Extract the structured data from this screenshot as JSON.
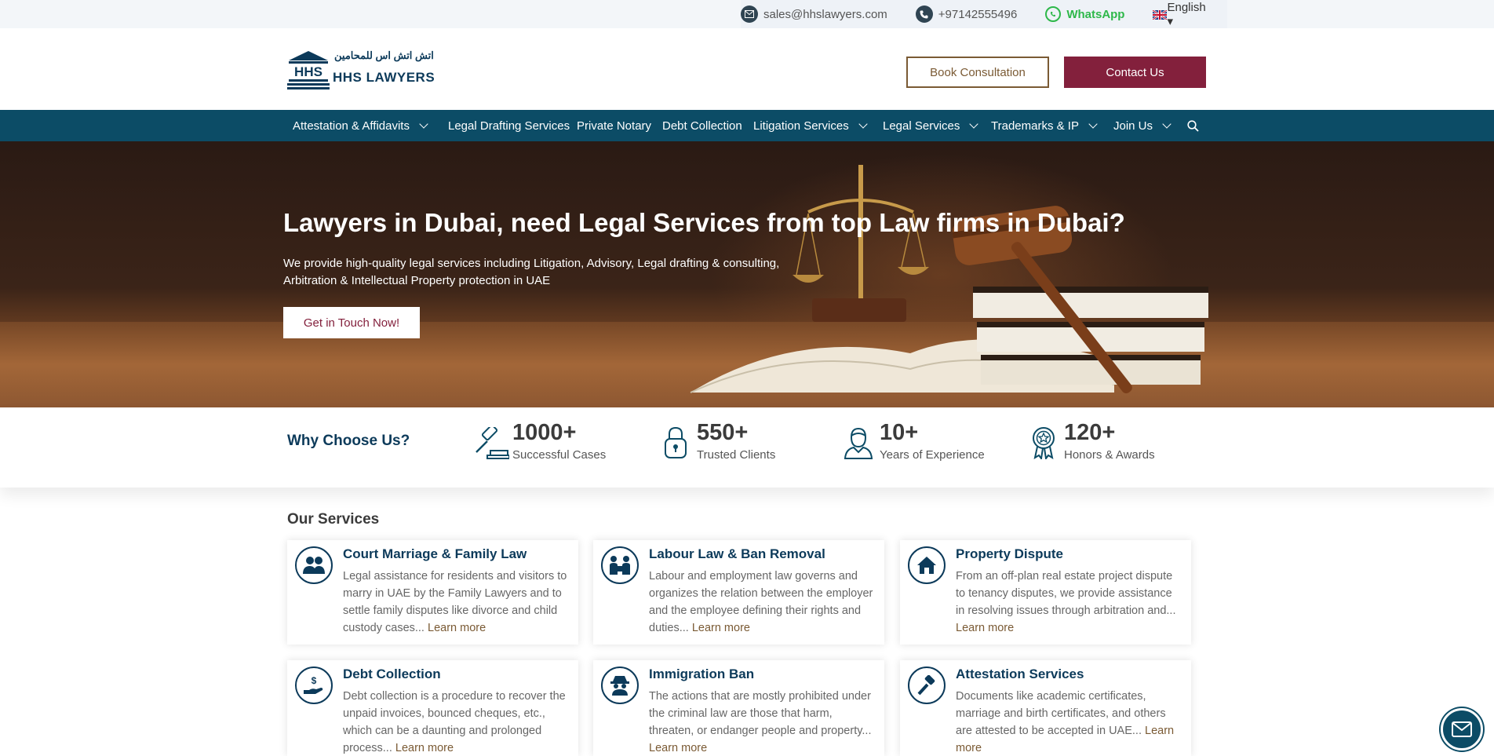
{
  "topbar": {
    "email": "sales@hhslawyers.com",
    "phone": "+97142555496",
    "whatsapp": "WhatsApp",
    "language": "English ▾"
  },
  "header": {
    "logo_mark": "HHS",
    "logo_arabic": "اتش اتش اس للمحامين",
    "logo_name": "HHS LAWYERS",
    "book_label": "Book Consultation",
    "contact_label": "Contact Us"
  },
  "nav": {
    "items": [
      {
        "label": "Attestation & Affidavits",
        "has_dropdown": true
      },
      {
        "label": "Legal Drafting Services",
        "has_dropdown": false
      },
      {
        "label": "Private Notary",
        "has_dropdown": false
      },
      {
        "label": "Debt Collection",
        "has_dropdown": false
      },
      {
        "label": "Litigation Services",
        "has_dropdown": true
      },
      {
        "label": "Legal Services",
        "has_dropdown": true
      },
      {
        "label": "Trademarks & IP",
        "has_dropdown": true
      },
      {
        "label": "Join Us",
        "has_dropdown": true
      }
    ],
    "search_icon": "search-icon"
  },
  "hero": {
    "title": "Lawyers in Dubai, need Legal Services from top Law firms in Dubai?",
    "subtitle_line1": "We provide high-quality legal services including Litigation, Advisory, Legal drafting & consulting,",
    "subtitle_line2": "Arbitration & Intellectual Property protection in UAE",
    "cta": "Get in Touch Now!"
  },
  "stats": {
    "heading": "Why Choose Us?",
    "items": [
      {
        "value": "1000+",
        "label": "Successful Cases",
        "icon": "gavel-icon"
      },
      {
        "value": "550+",
        "label": "Trusted Clients",
        "icon": "lock-icon"
      },
      {
        "value": "10+",
        "label": "Years of Experience",
        "icon": "person-icon"
      },
      {
        "value": "120+",
        "label": "Honors & Awards",
        "icon": "award-icon"
      }
    ]
  },
  "services": {
    "heading": "Our Services",
    "learn_more": "Learn more",
    "cards": [
      {
        "title": "Court Marriage & Family Law",
        "text": "Legal assistance for residents and visitors to marry in UAE by the Family Lawyers and to settle family disputes like divorce and child custody cases...",
        "icon": "family-icon"
      },
      {
        "title": "Labour Law & Ban Removal",
        "text": "Labour and employment law governs and organizes the relation between the employer and the employee defining their rights and duties...",
        "icon": "workers-icon"
      },
      {
        "title": "Property Dispute",
        "text": "From an off-plan real estate project dispute to tenancy disputes, we provide assistance in resolving issues through arbitration and...",
        "icon": "house-icon"
      },
      {
        "title": "Debt Collection",
        "text": "Debt collection is a procedure to recover the unpaid invoices, bounced cheques, etc., which can be a daunting and prolonged process...",
        "icon": "money-hand-icon"
      },
      {
        "title": "Immigration Ban",
        "text": "The actions that are mostly prohibited under the criminal law are those that harm, threaten, or endanger people and property...",
        "icon": "spy-icon"
      },
      {
        "title": "Attestation Services",
        "text": "Documents like academic certificates, marriage and birth certificates, and others are attested to be accepted in UAE...",
        "icon": "stamp-icon"
      }
    ]
  },
  "colors": {
    "navy": "#0c4c66",
    "brand_text": "#0c3a5a",
    "maroon": "#83203c",
    "gold": "#7a5a34"
  }
}
